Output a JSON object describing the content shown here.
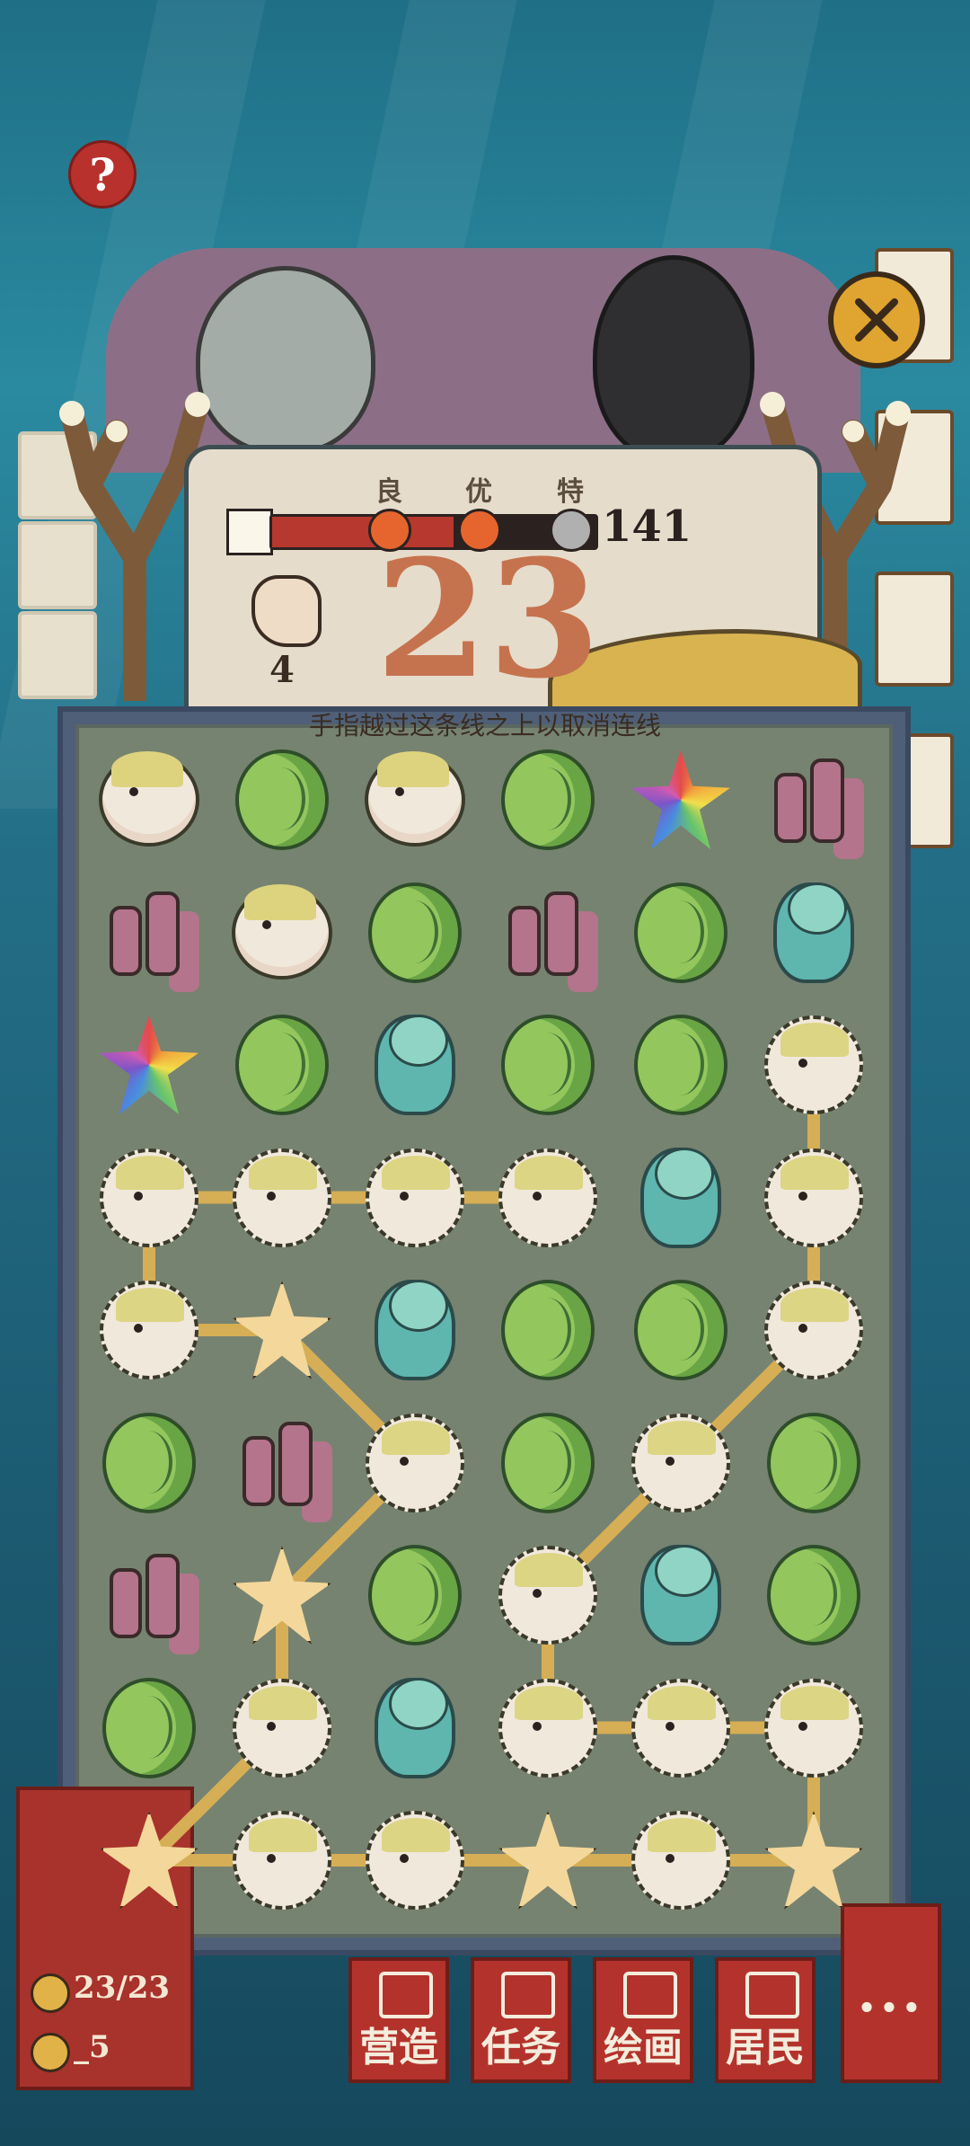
{
  "header": {
    "help_icon": "question-mark-icon",
    "help_label": "?",
    "close_icon": "close-x-icon",
    "ratings": [
      "良",
      "优",
      "特"
    ],
    "target_score": "141",
    "moves_left": "4",
    "current_count": "23",
    "progress_fraction": 0.56
  },
  "board": {
    "hint": "手指越过这条线之上以取消连线",
    "rows": [
      [
        "puffer",
        "shell",
        "puffer",
        "shell",
        "rainbow-star",
        "coral"
      ],
      [
        "coral",
        "puffer",
        "shell",
        "coral",
        "shell",
        "clam"
      ],
      [
        "rainbow-star",
        "shell",
        "clam",
        "shell",
        "shell",
        "spiky-puffer"
      ],
      [
        "spiky-puffer",
        "spiky-puffer",
        "spiky-puffer",
        "spiky-puffer",
        "clam",
        "spiky-puffer"
      ],
      [
        "spiky-puffer",
        "starfish",
        "clam",
        "shell",
        "shell",
        "spiky-puffer"
      ],
      [
        "shell",
        "coral",
        "spiky-puffer",
        "shell",
        "spiky-puffer",
        "shell"
      ],
      [
        "coral",
        "starfish",
        "shell",
        "spiky-puffer",
        "clam",
        "shell"
      ],
      [
        "shell",
        "spiky-puffer",
        "clam",
        "spiky-puffer",
        "spiky-puffer",
        "spiky-puffer"
      ],
      [
        "starfish",
        "spiky-puffer",
        "spiky-puffer",
        "starfish",
        "spiky-puffer",
        "starfish"
      ]
    ],
    "links": [
      [
        [
          3,
          0
        ],
        [
          3,
          1
        ]
      ],
      [
        [
          3,
          1
        ],
        [
          3,
          2
        ]
      ],
      [
        [
          3,
          2
        ],
        [
          3,
          3
        ]
      ],
      [
        [
          3,
          0
        ],
        [
          4,
          0
        ]
      ],
      [
        [
          4,
          0
        ],
        [
          4,
          1
        ]
      ],
      [
        [
          4,
          1
        ],
        [
          5,
          2
        ]
      ],
      [
        [
          5,
          2
        ],
        [
          6,
          1
        ]
      ],
      [
        [
          6,
          1
        ],
        [
          7,
          1
        ]
      ],
      [
        [
          7,
          1
        ],
        [
          8,
          0
        ]
      ],
      [
        [
          8,
          0
        ],
        [
          8,
          1
        ]
      ],
      [
        [
          8,
          1
        ],
        [
          8,
          2
        ]
      ],
      [
        [
          8,
          2
        ],
        [
          8,
          3
        ]
      ],
      [
        [
          8,
          3
        ],
        [
          8,
          4
        ]
      ],
      [
        [
          8,
          4
        ],
        [
          8,
          5
        ]
      ],
      [
        [
          8,
          5
        ],
        [
          7,
          5
        ]
      ],
      [
        [
          7,
          5
        ],
        [
          7,
          4
        ]
      ],
      [
        [
          7,
          4
        ],
        [
          7,
          3
        ]
      ],
      [
        [
          7,
          3
        ],
        [
          6,
          3
        ]
      ],
      [
        [
          6,
          3
        ],
        [
          5,
          4
        ]
      ],
      [
        [
          5,
          4
        ],
        [
          4,
          5
        ]
      ],
      [
        [
          4,
          5
        ],
        [
          3,
          5
        ]
      ],
      [
        [
          3,
          5
        ],
        [
          2,
          5
        ]
      ]
    ]
  },
  "hud": {
    "population": "23/23",
    "coins": "_5",
    "nav": [
      {
        "label": "营造",
        "icon": "build-icon"
      },
      {
        "label": "任务",
        "icon": "task-icon"
      },
      {
        "label": "绘画",
        "icon": "paint-icon"
      },
      {
        "label": "居民",
        "icon": "resident-icon"
      }
    ],
    "more_label": "..."
  },
  "colors": {
    "accent_red": "#b3332c",
    "count_orange": "#c5734e",
    "board_bg": "#768370"
  }
}
